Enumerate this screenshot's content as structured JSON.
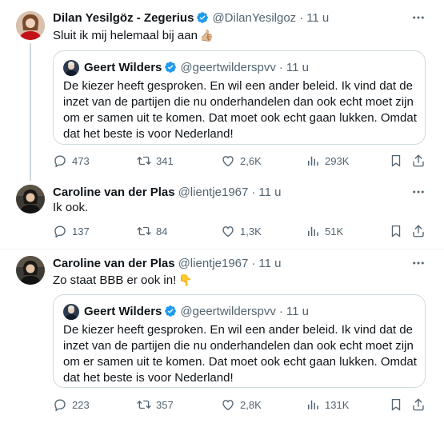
{
  "tweets": [
    {
      "name": "Dilan Yesilgöz - Zegerius",
      "handle": "@DilanYesilgoz",
      "separator": "·",
      "time": "11 u",
      "text": "Sluit ik mij helemaal bij aan",
      "emoji": "👍🏼",
      "avatar_icon": "person-avatar-red",
      "quote": {
        "name": "Geert Wilders",
        "handle": "@geertwilderspvv",
        "separator": "·",
        "time": "11 u",
        "text": "De kiezer heeft gesproken. En wil een ander beleid. Ik vind dat de inzet van de partijen die nu onderhandelen dan ook echt moet zijn om er samen uit te komen. Dat moet ook echt gaan lukken. Omdat dat het beste is voor Nederland!"
      },
      "stats": {
        "replies": "473",
        "reposts": "341",
        "likes": "2,6K",
        "views": "293K"
      }
    },
    {
      "name": "Caroline van der Plas",
      "handle": "@lientje1967",
      "separator": "·",
      "time": "11 u",
      "text": "Ik ook.",
      "avatar_icon": "person-avatar-dark",
      "stats": {
        "replies": "137",
        "reposts": "84",
        "likes": "1,3K",
        "views": "51K"
      }
    },
    {
      "name": "Caroline van der Plas",
      "handle": "@lientje1967",
      "separator": "·",
      "time": "11 u",
      "text": "Zo staat BBB er ook in!",
      "emoji": "👇",
      "avatar_icon": "person-avatar-dark",
      "quote": {
        "name": "Geert Wilders",
        "handle": "@geertwilderspvv",
        "separator": "·",
        "time": "11 u",
        "text": "De kiezer heeft gesproken. En wil een ander beleid. Ik vind dat de inzet van de partijen die nu onderhandelen dan ook echt moet zijn om er samen uit te komen. Dat moet ook echt gaan lukken. Omdat dat het beste is voor Nederland!"
      },
      "stats": {
        "replies": "223",
        "reposts": "357",
        "likes": "2,8K",
        "views": "131K"
      }
    }
  ],
  "colors": {
    "verified": "#1d9bf0",
    "muted": "#536471",
    "border": "#cfd9de",
    "text": "#0f1419"
  }
}
